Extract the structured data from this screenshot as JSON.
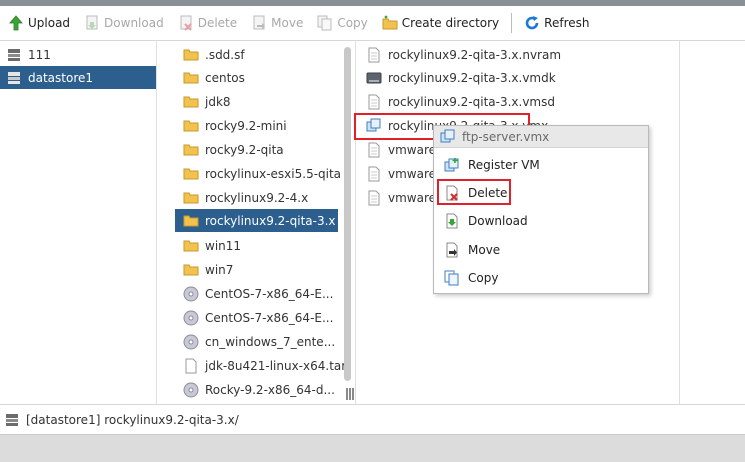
{
  "toolbar": {
    "upload": "Upload",
    "download": "Download",
    "delete": "Delete",
    "move": "Move",
    "copy": "Copy",
    "create_directory": "Create directory",
    "refresh": "Refresh"
  },
  "datastores": [
    "111",
    "datastore1"
  ],
  "folders": [
    ".sdd.sf",
    "centos",
    "jdk8",
    "rocky9.2-mini",
    "rocky9.2-qita",
    "rockylinux-esxi5.5-qita",
    "rockylinux9.2-4.x",
    "rockylinux9.2-qita-3.x",
    "win11",
    "win7"
  ],
  "folder_files": [
    "CentOS-7-x86_64-E...",
    "CentOS-7-x86_64-E...",
    "cn_windows_7_ente...",
    "jdk-8u421-linux-x64.tar",
    "Rocky-9.2-x86_64-d..."
  ],
  "files": [
    "rockylinux9.2-qita-3.x.nvram",
    "rockylinux9.2-qita-3.x.vmdk",
    "rockylinux9.2-qita-3.x.vmsd",
    "rockylinux9.2-qita-3.x.vmx",
    "vmware-",
    "vmware-",
    "vmware.l"
  ],
  "context_menu": {
    "title": "ftp-server.vmx",
    "register_vm": "Register VM",
    "delete": "Delete",
    "download": "Download",
    "move": "Move",
    "copy": "Copy"
  },
  "status": {
    "path": "[datastore1] rockylinux9.2-qita-3.x/"
  },
  "colors": {
    "selection": "#2c5f8d",
    "highlight": "#e0202a",
    "folder": "#f2c14e"
  }
}
